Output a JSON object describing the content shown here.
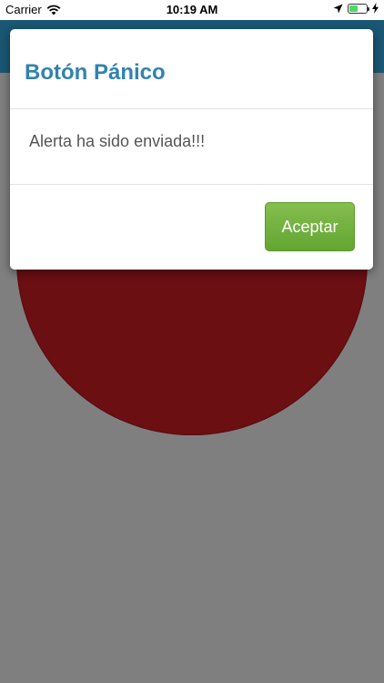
{
  "status_bar": {
    "carrier": "Carrier",
    "time": "10:19 AM",
    "icons": [
      "wifi-icon",
      "location-icon",
      "battery-icon",
      "bolt-icon"
    ],
    "battery_level": 0.5
  },
  "dialog": {
    "title": "Botón Pánico",
    "message": "Alerta ha sido enviada!!!",
    "accept_label": "Aceptar"
  },
  "colors": {
    "nav_bar": "#1a5773",
    "panic_button": "#6b0f13",
    "title": "#3182b0",
    "accept_button": "#6aaa3a",
    "backdrop": "#7f7f7f"
  }
}
